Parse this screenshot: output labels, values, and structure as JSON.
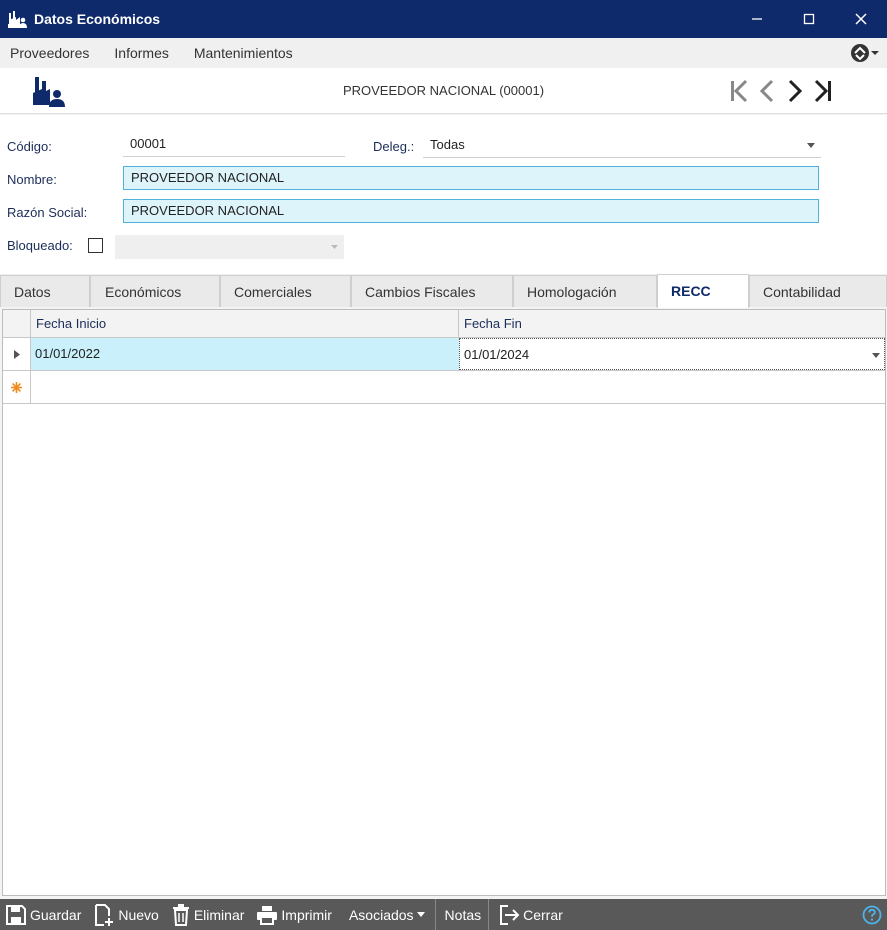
{
  "window": {
    "title": "Datos Económicos"
  },
  "menu": {
    "items": [
      "Proveedores",
      "Informes",
      "Mantenimientos"
    ]
  },
  "record": {
    "title": "PROVEEDOR NACIONAL (00001)"
  },
  "form": {
    "codigo_label": "Código:",
    "codigo_value": "00001",
    "deleg_label": "Deleg.:",
    "deleg_value": "Todas",
    "nombre_label": "Nombre:",
    "nombre_value": "PROVEEDOR NACIONAL",
    "razon_label": "Razón Social:",
    "razon_value": "PROVEEDOR NACIONAL",
    "bloqueado_label": "Bloqueado:"
  },
  "tabs": [
    "Datos",
    "Económicos",
    "Comerciales",
    "Cambios Fiscales",
    "Homologación",
    "RECC",
    "Contabilidad"
  ],
  "grid": {
    "columns": [
      "Fecha Inicio",
      "Fecha Fin"
    ],
    "rows": [
      {
        "fecha_inicio": "01/01/2022",
        "fecha_fin": "01/01/2024"
      }
    ]
  },
  "toolbar": {
    "guardar": "Guardar",
    "nuevo": "Nuevo",
    "eliminar": "Eliminar",
    "imprimir": "Imprimir",
    "asociados": "Asociados",
    "notas": "Notas",
    "cerrar": "Cerrar"
  },
  "colors": {
    "titlebar": "#0f2a6b",
    "accent_cell": "#c9f0fb",
    "toolbar": "#595959"
  }
}
